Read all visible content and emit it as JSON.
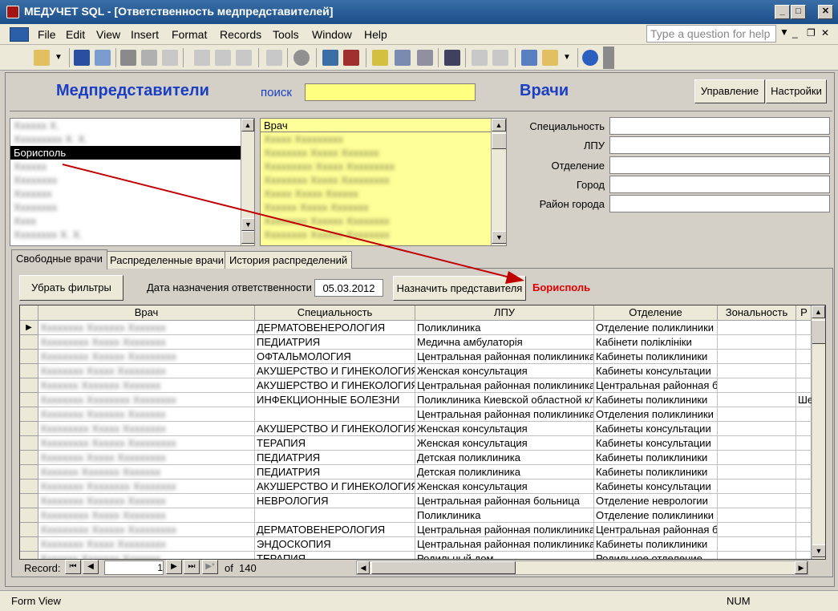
{
  "window": {
    "title": "МЕДУЧЕТ SQL - [Ответственность медпредставителей]"
  },
  "menu": [
    "File",
    "Edit",
    "View",
    "Insert",
    "Format",
    "Records",
    "Tools",
    "Window",
    "Help"
  ],
  "help_placeholder": "Type a question for help",
  "header": {
    "reps_title": "Медпредставители",
    "search_label": "поиск",
    "search_value": "",
    "doctors_title": "Врачи",
    "manage_button": "Управление",
    "settings_button": "Настройки"
  },
  "reps_list": {
    "selected": "Борисполь"
  },
  "doctors_list": {
    "header": "Врач"
  },
  "fields": {
    "specialty_label": "Специальность",
    "lpu_label": "ЛПУ",
    "department_label": "Отделение",
    "city_label": "Город",
    "district_label": "Район города"
  },
  "tabs": [
    "Свободные врачи",
    "Распределенные врачи",
    "История распределений"
  ],
  "filters": {
    "clear_button": "Убрать фильтры",
    "date_label": "Дата назначения ответственности",
    "date_value": "05.03.2012",
    "assign_button": "Назначить представителя",
    "assigned_rep": "Борисполь"
  },
  "grid": {
    "columns": [
      "Врач",
      "Специальность",
      "ЛПУ",
      "Отделение",
      "Зональность",
      "Р"
    ],
    "rows": [
      [
        "ДЕРМАТОВЕНЕРОЛОГИЯ",
        "Поликлиника",
        "Отделение поликлиники",
        "",
        ""
      ],
      [
        "ПЕДИАТРИЯ",
        "Медична амбулаторія",
        "Кабінети поліклініки",
        "",
        ""
      ],
      [
        "ОФТАЛЬМОЛОГИЯ",
        "Центральная районная поликлиника",
        "Кабинеты поликлиники",
        "",
        ""
      ],
      [
        "АКУШЕРСТВО И ГИНЕКОЛОГИЯ",
        "Женская консультация",
        "Кабинеты консультации",
        "",
        ""
      ],
      [
        "АКУШЕРСТВО И ГИНЕКОЛОГИЯ",
        "Центральная районная поликлиника",
        "Центральная районная б",
        "",
        ""
      ],
      [
        "ИНФЕКЦИОННЫЕ БОЛЕЗНИ",
        "Поликлиника Киевской областной кл",
        "Кабинеты поликлиники",
        "",
        "Шевче"
      ],
      [
        "",
        "Центральная районная поликлиника",
        "Отделения поликлиники",
        "",
        ""
      ],
      [
        "АКУШЕРСТВО И ГИНЕКОЛОГИЯ",
        "Женская консультация",
        "Кабинеты консультации",
        "",
        ""
      ],
      [
        "ТЕРАПИЯ",
        "Женская консультация",
        "Кабинеты консультации",
        "",
        ""
      ],
      [
        "ПЕДИАТРИЯ",
        "Детская поликлиника",
        "Кабинеты поликлиники",
        "",
        ""
      ],
      [
        "ПЕДИАТРИЯ",
        "Детская поликлиника",
        "Кабинеты поликлиники",
        "",
        ""
      ],
      [
        "АКУШЕРСТВО И ГИНЕКОЛОГИЯ",
        "Женская консультация",
        "Кабинеты консультации",
        "",
        ""
      ],
      [
        "НЕВРОЛОГИЯ",
        "Центральная районная больница",
        "Отделение неврологии",
        "",
        ""
      ],
      [
        "",
        "Поликлиника",
        "Отделение поликлиники",
        "",
        ""
      ],
      [
        "ДЕРМАТОВЕНЕРОЛОГИЯ",
        "Центральная районная поликлиника",
        "Центральная районная б",
        "",
        ""
      ],
      [
        "ЭНДОСКОПИЯ",
        "Центральная районная поликлиника",
        "Кабинеты поликлиники",
        "",
        ""
      ],
      [
        "ТЕРАПИЯ",
        "Родильный дом",
        "Родильное отделение",
        "",
        ""
      ]
    ]
  },
  "navigator": {
    "label": "Record:",
    "current": "1",
    "of_label": "of",
    "total": "140"
  },
  "status": {
    "mode": "Form View",
    "num": "NUM"
  }
}
